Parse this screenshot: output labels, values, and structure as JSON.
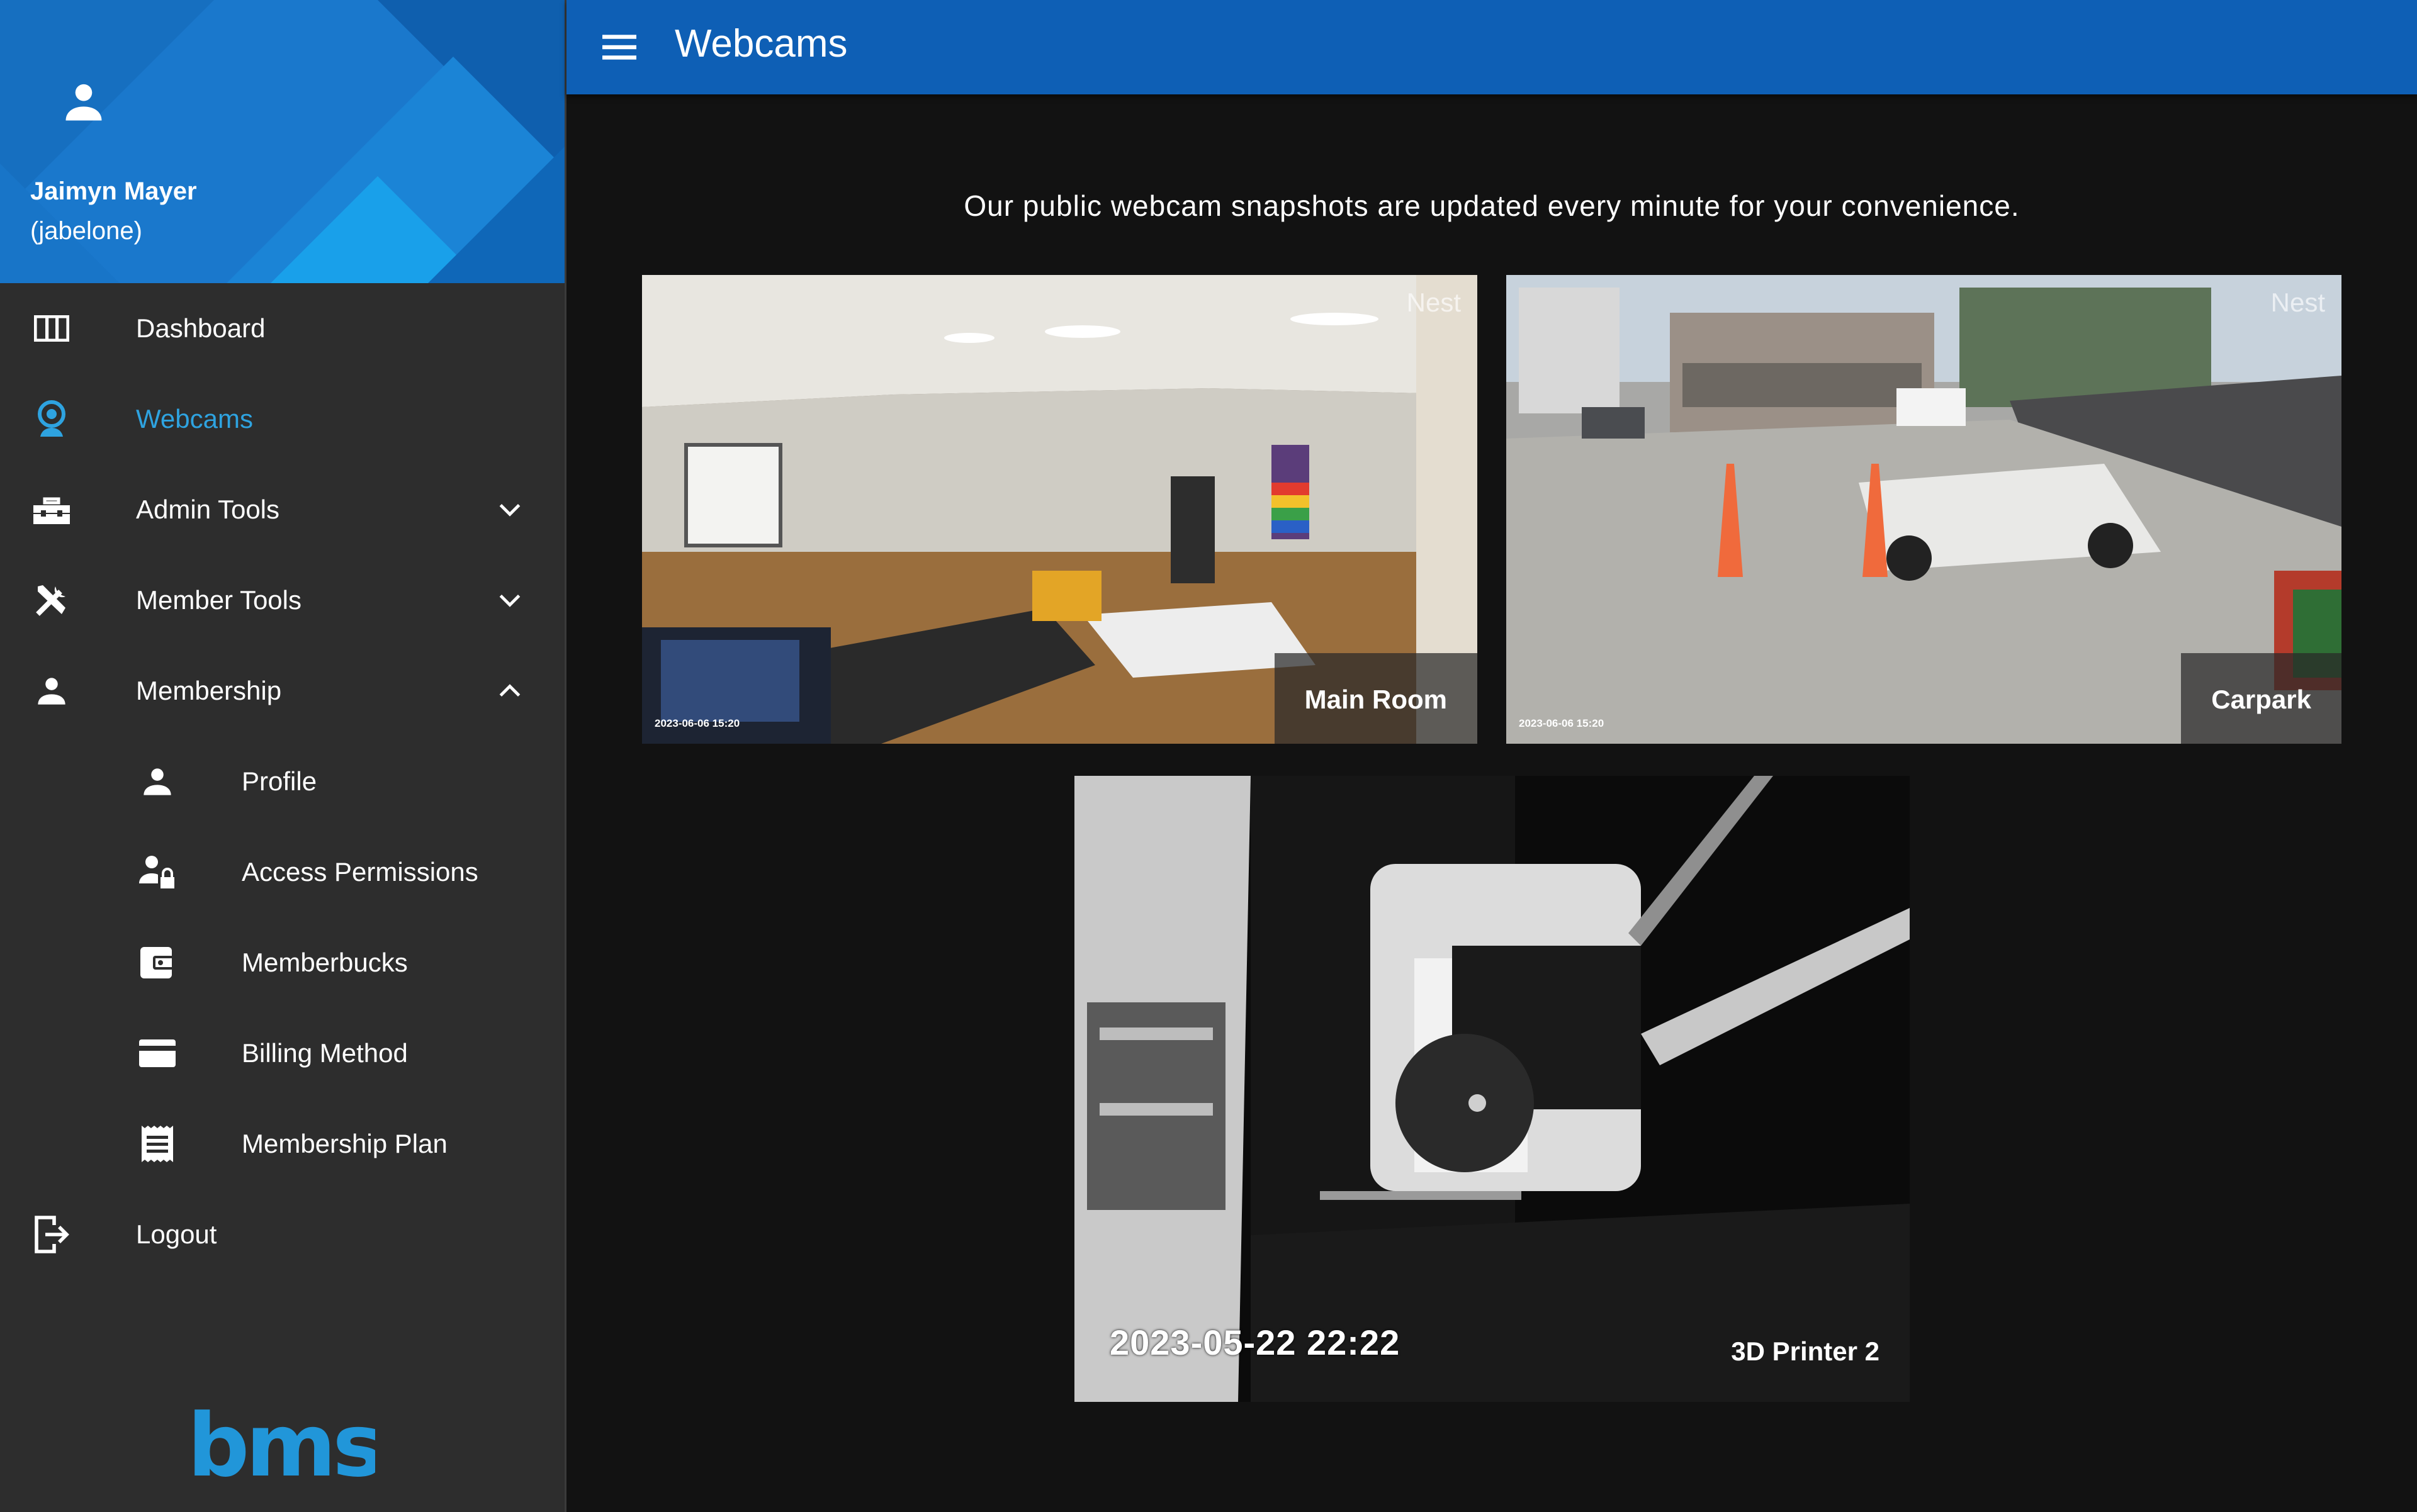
{
  "user": {
    "name": "Jaimyn Mayer",
    "handle": "(jabelone)"
  },
  "nav": {
    "dashboard": "Dashboard",
    "webcams": "Webcams",
    "admin_tools": "Admin Tools",
    "member_tools": "Member Tools",
    "membership": "Membership",
    "profile": "Profile",
    "access_permissions": "Access Permissions",
    "memberbucks": "Memberbucks",
    "billing_method": "Billing Method",
    "membership_plan": "Membership Plan",
    "logout": "Logout"
  },
  "logo": {
    "text": "bms",
    "color": "#2196d9"
  },
  "appbar": {
    "title": "Webcams",
    "color": "#0e5fb5"
  },
  "intro": "Our public webcam snapshots are updated every minute for your convenience.",
  "cameras": [
    {
      "label": "Main Room",
      "timestamp": "2023-06-06 15:20",
      "watermark": "Nest"
    },
    {
      "label": "Carpark",
      "timestamp": "2023-06-06 15:20",
      "watermark": "Nest"
    },
    {
      "label": "3D Printer 2",
      "timestamp": "2023-05-22 22:22"
    }
  ],
  "colors": {
    "accent": "#2ea3e0",
    "sidebar": "#2d2d2d",
    "background": "#121212"
  }
}
